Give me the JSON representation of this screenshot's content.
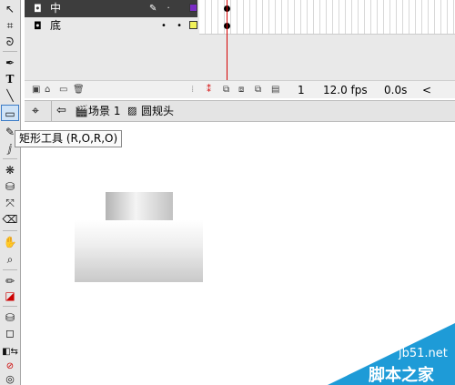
{
  "tools": [
    {
      "name": "selection-tool",
      "glyph": "↖"
    },
    {
      "name": "free-transform-tool",
      "glyph": "⌗"
    },
    {
      "name": "lasso-tool",
      "glyph": "ᘐ"
    },
    {
      "name": "pen-tool",
      "glyph": "✒"
    },
    {
      "name": "text-tool",
      "glyph": "T"
    },
    {
      "name": "line-tool",
      "glyph": "╲"
    },
    {
      "name": "rectangle-tool",
      "glyph": "▭"
    },
    {
      "name": "pencil-tool",
      "glyph": "✎"
    },
    {
      "name": "brush-tool",
      "glyph": "🖌"
    },
    {
      "name": "deco-tool",
      "glyph": "❋"
    },
    {
      "name": "paint-bucket-tool",
      "glyph": "⛁"
    },
    {
      "name": "eyedropper-tool",
      "glyph": "⤧"
    },
    {
      "name": "eraser-tool",
      "glyph": "⌫"
    },
    {
      "name": "hand-tool",
      "glyph": "✋"
    },
    {
      "name": "zoom-tool",
      "glyph": "🔍"
    },
    {
      "name": "stroke-color-tool",
      "glyph": "✏"
    },
    {
      "name": "fill-color-tool",
      "glyph": "◩"
    }
  ],
  "timeline": {
    "layers": [
      {
        "name": "中",
        "color": "#7a2bc4",
        "selected": true
      },
      {
        "name": "底",
        "color": "#f2f25a",
        "selected": false
      }
    ],
    "current_frame": "1",
    "fps": "12.0 fps",
    "time": "0.0s"
  },
  "editbar": {
    "scene": "场景 1",
    "symbol": "圆规头"
  },
  "tooltip": "矩形工具 (R,O,R,O)",
  "watermark": {
    "url": "jb51.net",
    "brand": "脚本之家"
  }
}
